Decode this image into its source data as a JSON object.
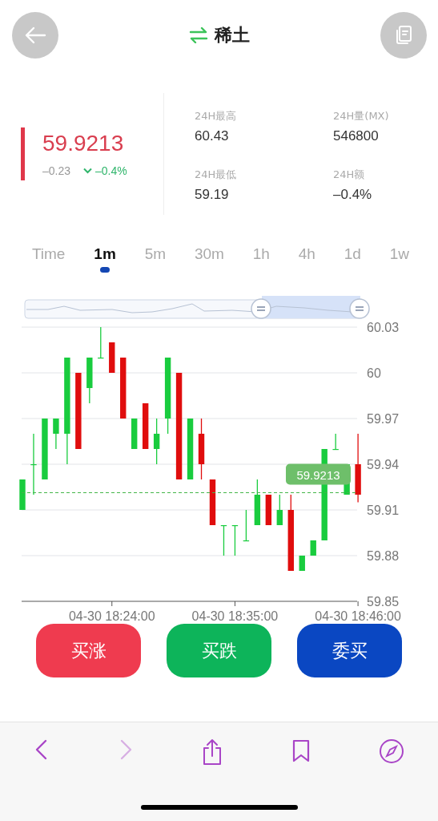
{
  "header": {
    "title": "稀土"
  },
  "price": {
    "last": "59.9213",
    "change": "–0.23",
    "change_pct": "–0.4%"
  },
  "stats": [
    {
      "label": "24H最高",
      "value": "60.43"
    },
    {
      "label": "24H量(MX)",
      "value": "546800"
    },
    {
      "label": "24H最低",
      "value": "59.19"
    },
    {
      "label": "24H额",
      "value": "–0.4%"
    }
  ],
  "periods": [
    {
      "label": "Time",
      "selected": false
    },
    {
      "label": "1m",
      "selected": true
    },
    {
      "label": "5m",
      "selected": false
    },
    {
      "label": "30m",
      "selected": false
    },
    {
      "label": "1h",
      "selected": false
    },
    {
      "label": "4h",
      "selected": false
    },
    {
      "label": "1d",
      "selected": false
    },
    {
      "label": "1w",
      "selected": false
    }
  ],
  "chart": {
    "y_axis_labels": [
      "60.03",
      "60",
      "59.97",
      "59.94",
      "59.91",
      "59.88",
      "59.85"
    ],
    "x_axis_labels": [
      "04-30 18:24:00",
      "04-30 18:35:00",
      "04-30 18:46:00"
    ],
    "price_tag": "59.9213"
  },
  "actions": [
    {
      "label": "买涨",
      "kind": "buy-up"
    },
    {
      "label": "买跌",
      "kind": "buy-down"
    },
    {
      "label": "委买",
      "kind": "order"
    }
  ],
  "browser_toolbar": [
    {
      "kind": "back",
      "disabled": false
    },
    {
      "kind": "forward",
      "disabled": true
    },
    {
      "kind": "share",
      "disabled": false
    },
    {
      "kind": "bookmarks",
      "disabled": false
    },
    {
      "kind": "compass",
      "disabled": false
    }
  ]
}
